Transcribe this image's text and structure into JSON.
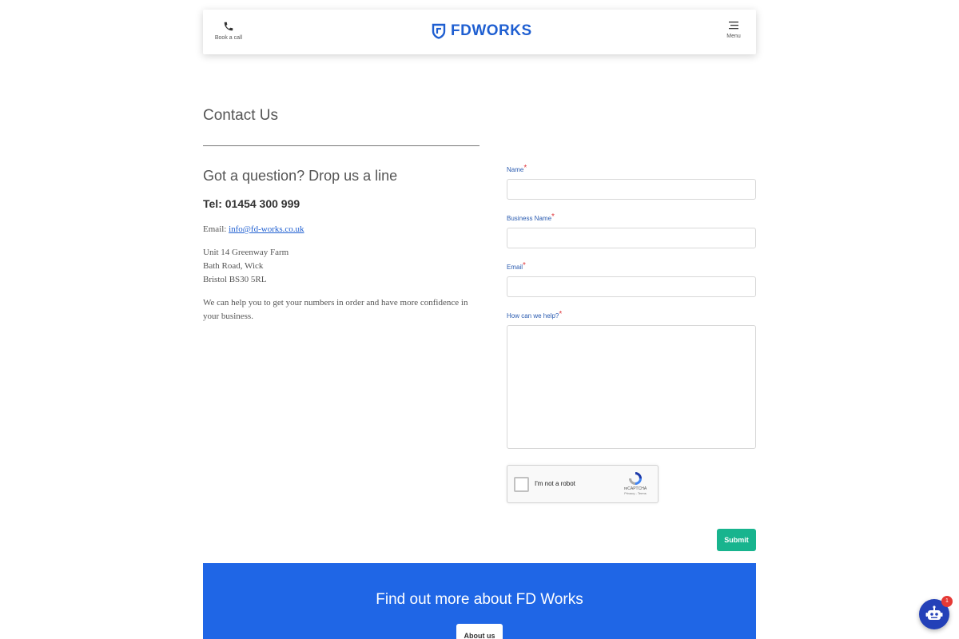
{
  "header": {
    "book_call_label": "Book a call",
    "logo_text": "FDWORKS",
    "menu_label": "Menu",
    "brand_color": "#1f5fd1"
  },
  "contact": {
    "page_title": "Contact Us",
    "sub_heading": "Got a question? Drop us a line",
    "tel": "Tel: 01454 300 999",
    "email_prefix": "Email: ",
    "email": "info@fd-works.co.uk",
    "address_lines": [
      "Unit 14 Greenway Farm",
      "Bath Road, Wick",
      "Bristol BS30 5RL"
    ],
    "blurb": "We can help you to get your numbers in order and have more confidence in your business."
  },
  "form": {
    "fields": [
      {
        "label": "Name",
        "required_mark": "*",
        "value": ""
      },
      {
        "label": "Business Name",
        "required_mark": "*",
        "value": ""
      },
      {
        "label": "Email",
        "required_mark": "*",
        "value": ""
      },
      {
        "label": "How can we help?",
        "required_mark": "*",
        "value": ""
      }
    ],
    "captcha": {
      "label": "I'm not a robot",
      "brand": "reCAPTCHA",
      "links": "Privacy - Terms",
      "checked": false
    },
    "submit_label": "Submit",
    "submit_color": "#18b48e"
  },
  "banner": {
    "title": "Find out more about FD Works",
    "button_label": "About us",
    "color": "#1f66e6"
  },
  "chatbot": {
    "badge_count": "1",
    "icon": "robot-icon"
  }
}
